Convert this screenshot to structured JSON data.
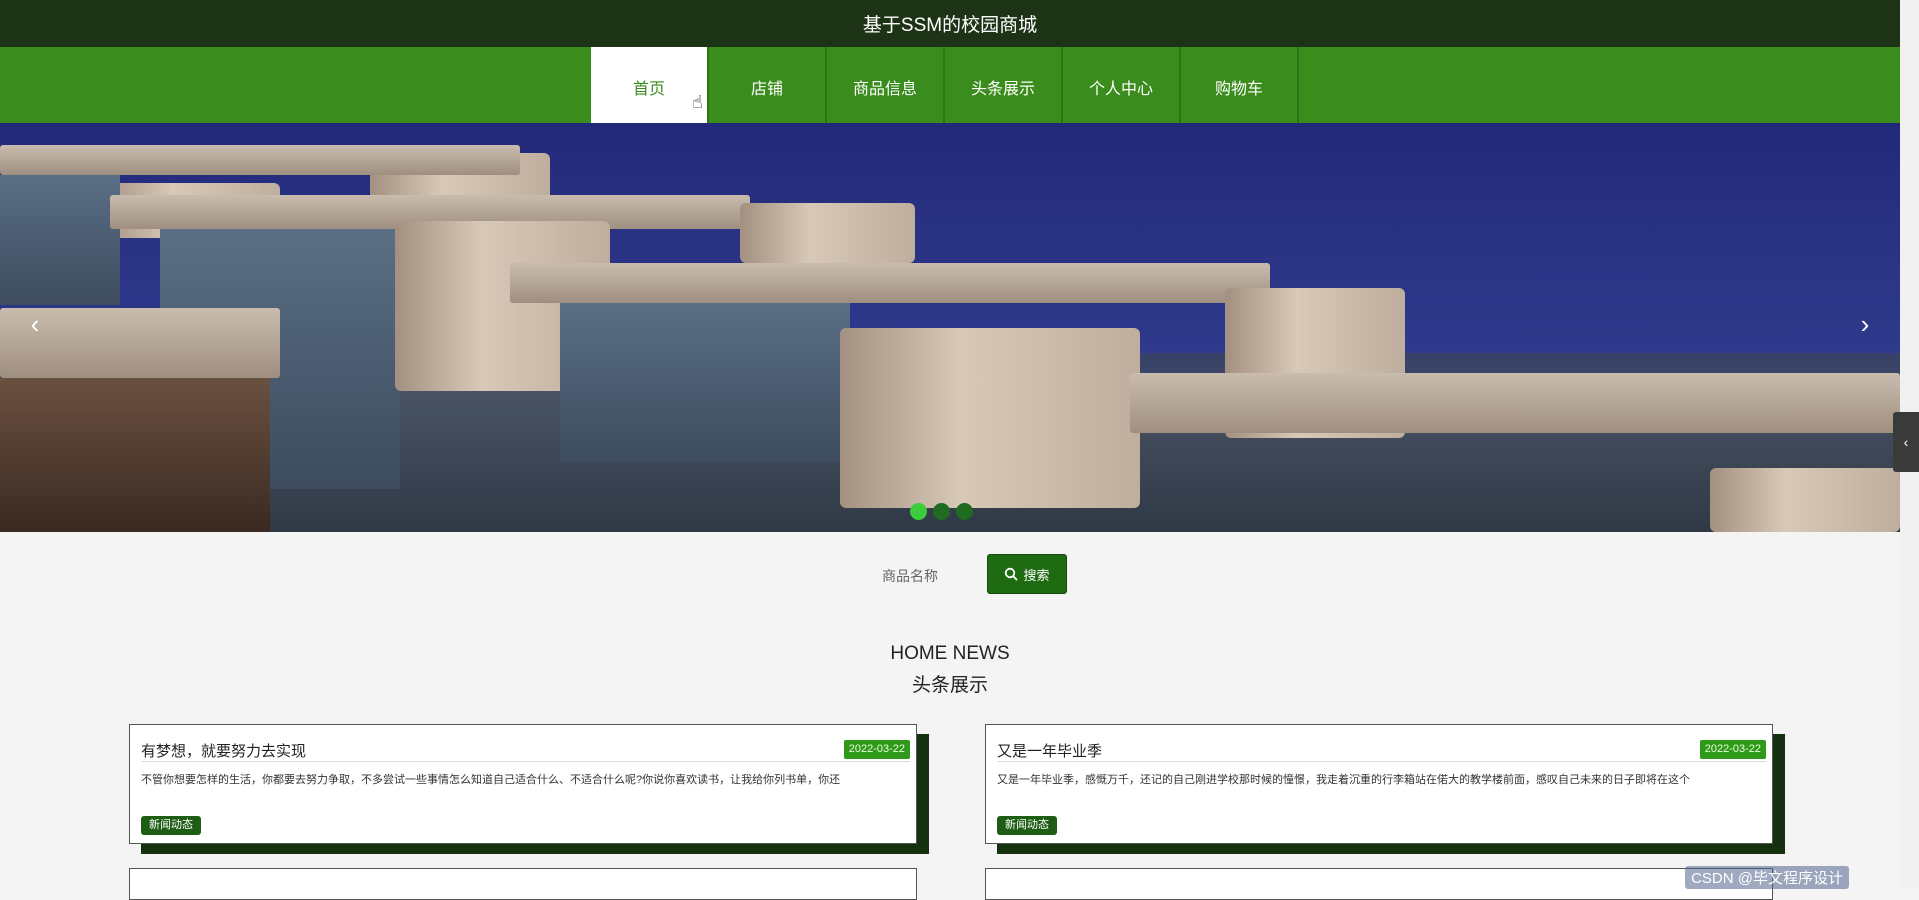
{
  "app": {
    "title": "基于SSM的校园商城"
  },
  "nav": {
    "items": [
      {
        "label": "首页"
      },
      {
        "label": "店铺"
      },
      {
        "label": "商品信息"
      },
      {
        "label": "头条展示"
      },
      {
        "label": "个人中心"
      },
      {
        "label": "购物车"
      }
    ]
  },
  "carousel": {
    "prev_icon": "‹",
    "next_icon": "›",
    "slide_count": 3,
    "active_slide": 1
  },
  "search": {
    "label": "商品名称",
    "placeholder": "",
    "button_label": "搜索"
  },
  "news_section": {
    "title_en": "HOME NEWS",
    "title_cn": "头条展示",
    "items": [
      {
        "title": "有梦想，就要努力去实现",
        "date": "2022-03-22",
        "excerpt": "不管你想要怎样的生活，你都要去努力争取，不多尝试一些事情怎么知道自己适合什么、不适合什么呢?你说你喜欢读书，让我给你列书单，你还",
        "tag": "新闻动态"
      },
      {
        "title": "又是一年毕业季",
        "date": "2022-03-22",
        "excerpt": "又是一年毕业季，感慨万千，还记的自己刚进学校那时候的憧憬，我走着沉重的行李箱站在偌大的教学楼前面，感叹自己未来的日子即将在这个",
        "tag": "新闻动态"
      }
    ]
  },
  "side_toggle": {
    "icon": "‹"
  },
  "watermark": "CSDN @毕文程序设计"
}
